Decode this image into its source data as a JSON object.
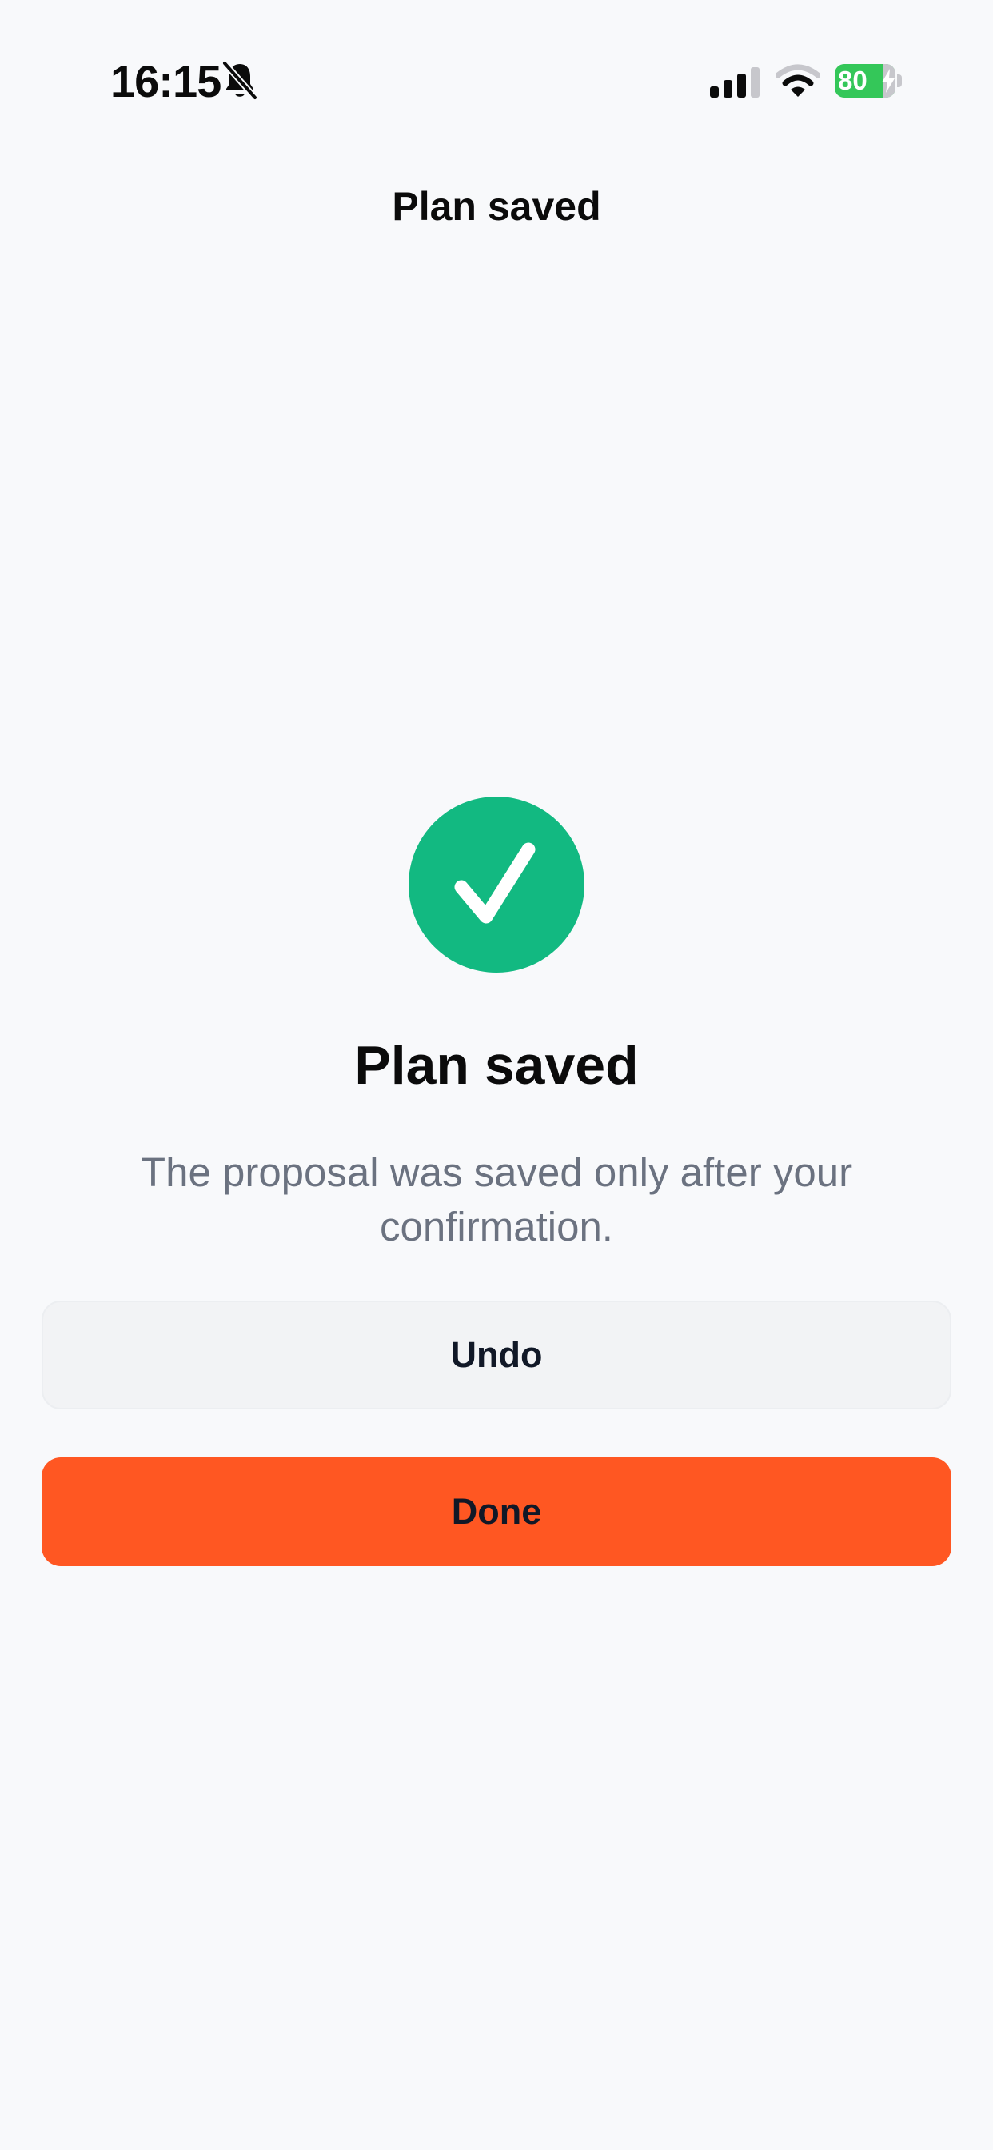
{
  "status_bar": {
    "time": "16:15",
    "battery_level": "80",
    "icons": {
      "silent": "bell-slash-icon",
      "signal": "cellular-signal-icon",
      "wifi": "wifi-icon",
      "battery": "battery-charging-icon"
    }
  },
  "nav": {
    "title": "Plan saved"
  },
  "content": {
    "icon": "checkmark-circle-icon",
    "title": "Plan saved",
    "description": "The proposal was saved only after your confirmation."
  },
  "actions": {
    "undo_label": "Undo",
    "done_label": "Done"
  },
  "colors": {
    "success": "#12B981",
    "primary": "#FF5722",
    "secondary_button": "#F2F3F5",
    "battery": "#34C759",
    "muted_text": "#6B7280"
  }
}
